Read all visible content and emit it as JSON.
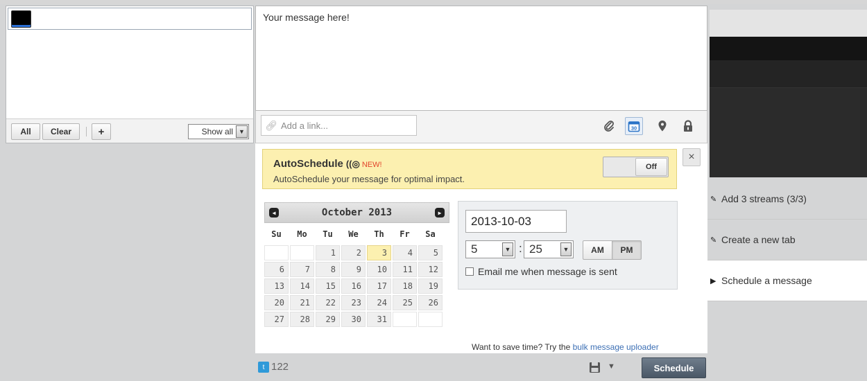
{
  "profile_picker": {
    "buttons": {
      "all": "All",
      "clear": "Clear",
      "add": "+"
    },
    "filter": {
      "value": "Show all"
    }
  },
  "composer": {
    "message_text": "Your message here!",
    "link_placeholder": "Add a link...",
    "toolbar_icons": [
      "paperclip-icon",
      "calendar-icon",
      "location-pin-icon",
      "lock-icon"
    ],
    "calendar_icon_day": "30"
  },
  "autoschedule": {
    "title": "AutoSchedule",
    "badge": "NEW!",
    "subtitle": "AutoSchedule your message for optimal impact.",
    "toggle": "Off",
    "close": "×"
  },
  "calendar": {
    "month_label": "October 2013",
    "weekdays": [
      "Su",
      "Mo",
      "Tu",
      "We",
      "Th",
      "Fr",
      "Sa"
    ],
    "weeks": [
      [
        "",
        "",
        "1",
        "2",
        "3",
        "4",
        "5"
      ],
      [
        "6",
        "7",
        "8",
        "9",
        "10",
        "11",
        "12"
      ],
      [
        "13",
        "14",
        "15",
        "16",
        "17",
        "18",
        "19"
      ],
      [
        "20",
        "21",
        "22",
        "23",
        "24",
        "25",
        "26"
      ],
      [
        "27",
        "28",
        "29",
        "30",
        "31",
        "",
        ""
      ]
    ],
    "selected_day": "3"
  },
  "time_picker": {
    "date": "2013-10-03",
    "hour": "5",
    "minute": "25",
    "am": "AM",
    "pm": "PM",
    "selected_period": "PM",
    "email_label": "Email me when message is sent"
  },
  "bulk": {
    "prefix": "Want to save time? Try the ",
    "link": "bulk message uploader"
  },
  "footer": {
    "char_count": "122",
    "schedule_label": "Schedule"
  },
  "side_tasks": [
    {
      "label": "Add 3 streams (3/3)",
      "icon": "pencil-icon"
    },
    {
      "label": "Create a new tab",
      "icon": "pencil-icon"
    },
    {
      "label": "Schedule a message",
      "icon": "arrow-right-icon"
    }
  ],
  "colors": {
    "autoschedule_bg": "#fcf0b0",
    "schedule_button": "#5a6776",
    "link": "#3c6fb4",
    "twitter": "#2f9ad9"
  }
}
